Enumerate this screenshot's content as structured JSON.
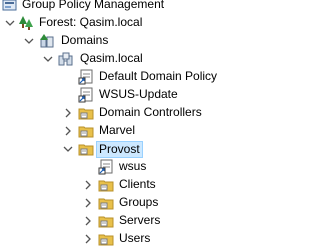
{
  "tree": {
    "items": [
      {
        "label": "Group Policy Management",
        "icon": "gpm-console-icon",
        "toggle": "none"
      },
      {
        "label": "Forest: Qasim.local",
        "icon": "forest-icon",
        "toggle": "expanded"
      },
      {
        "label": "Domains",
        "icon": "domains-icon",
        "toggle": "expanded"
      },
      {
        "label": "Qasim.local",
        "icon": "domain-icon",
        "toggle": "expanded"
      },
      {
        "label": "Default Domain Policy",
        "icon": "gpo-link-icon",
        "toggle": "none"
      },
      {
        "label": "WSUS-Update",
        "icon": "gpo-link-icon",
        "toggle": "none"
      },
      {
        "label": "Domain Controllers",
        "icon": "ou-folder-icon",
        "toggle": "collapsed"
      },
      {
        "label": "Marvel",
        "icon": "ou-folder-icon",
        "toggle": "collapsed"
      },
      {
        "label": "Provost",
        "icon": "ou-folder-icon",
        "toggle": "expanded",
        "selected": true
      },
      {
        "label": "wsus",
        "icon": "gpo-link-icon",
        "toggle": "none"
      },
      {
        "label": "Clients",
        "icon": "ou-folder-icon",
        "toggle": "collapsed"
      },
      {
        "label": "Groups",
        "icon": "ou-folder-icon",
        "toggle": "collapsed"
      },
      {
        "label": "Servers",
        "icon": "ou-folder-icon",
        "toggle": "collapsed"
      },
      {
        "label": "Users",
        "icon": "ou-folder-icon",
        "toggle": "collapsed"
      }
    ]
  },
  "colors": {
    "selection_bg": "#cce8ff",
    "selection_border": "#99d1ff",
    "folder": "#e8c04a",
    "toggle": "#555555"
  }
}
